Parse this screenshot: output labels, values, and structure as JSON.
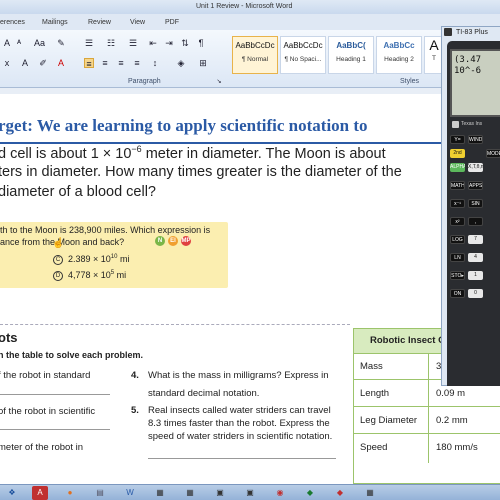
{
  "window": {
    "title": "Unit 1 Review - Microsoft Word"
  },
  "ribbon_tabs": [
    "erences",
    "Mailings",
    "Review",
    "View",
    "PDF"
  ],
  "ribbon": {
    "paragraph_label": "Paragraph",
    "styles_label": "Styles",
    "styles": [
      {
        "sample": "AaBbCcDc",
        "name": "¶ Normal"
      },
      {
        "sample": "AaBbCcDc",
        "name": "¶ No Spaci..."
      },
      {
        "sample": "AaBbC(",
        "name": "Heading 1"
      },
      {
        "sample": "AaBbCc",
        "name": "Heading 2"
      },
      {
        "sample": "A",
        "name": "T"
      }
    ]
  },
  "document": {
    "target": "rget:  We are learning to apply scientific notation to",
    "q1_line1": "d cell is about 1 × 10",
    "q1_exp": "−6",
    "q1_line1_end": " meter in diameter. The Moon is about",
    "q1_line2": "ters in diameter. How many times greater is the diameter of the",
    "q1_line3": "diameter of a blood cell?",
    "mc_line1": "th to the Moon is 238,900 miles. Which expression is",
    "mc_line2": "ance from the Moon and back?",
    "mc_badges": [
      "N",
      "EI",
      "MP"
    ],
    "mc_c_letter": "C",
    "mc_c": "2.389 × 10",
    "mc_c_exp": "10",
    "mc_c_unit": " mi",
    "mc_d_letter": "D",
    "mc_d": "4,778 × 10",
    "mc_d_exp": "5",
    "mc_d_unit": " mi",
    "robots_title": "ots",
    "robots_sub": "n the table to solve each problem.",
    "left_items": [
      "f the robot in standard",
      "of the robot in scientific",
      "meter of the robot in"
    ],
    "item4_num": "4.",
    "item4_line1": "What is the mass in milligrams? Express in",
    "item4_line2": "standard decimal notation.",
    "item5_num": "5.",
    "item5_line1": "Real insects called water striders can travel",
    "item5_line2": "8.3 times faster than the robot. Express the",
    "item5_line3": "speed of water striders in scientific notation.",
    "table": {
      "header": "Robotic Insect Cl",
      "rows": [
        {
          "label": "Mass",
          "value": "3"
        },
        {
          "label": "Length",
          "value": "0.09 m"
        },
        {
          "label": "Leg Diameter",
          "value": "0.2 mm"
        },
        {
          "label": "Speed",
          "value": "180 mm/s"
        }
      ]
    }
  },
  "calculator": {
    "window_title": "TI-83 Plus",
    "brand": "Texas Ins",
    "screen_line1": "(3.47",
    "screen_line2": "10^-6",
    "keys": [
      "Y=",
      "WINDOW",
      "MODE",
      "ALPHA",
      "X,T,θ,n",
      "MATH",
      "APPS",
      "x⁻¹",
      "SIN",
      "x²",
      ",",
      "LOG",
      "7",
      "LN",
      "4",
      "STO▸",
      "1",
      "ON",
      "0",
      "2nd"
    ]
  },
  "colors": {
    "target_blue": "#2b5aa5",
    "mc_bg": "#fbeeb0",
    "table_green": "#9cc46b",
    "table_header_bg": "#d8ebbf"
  }
}
